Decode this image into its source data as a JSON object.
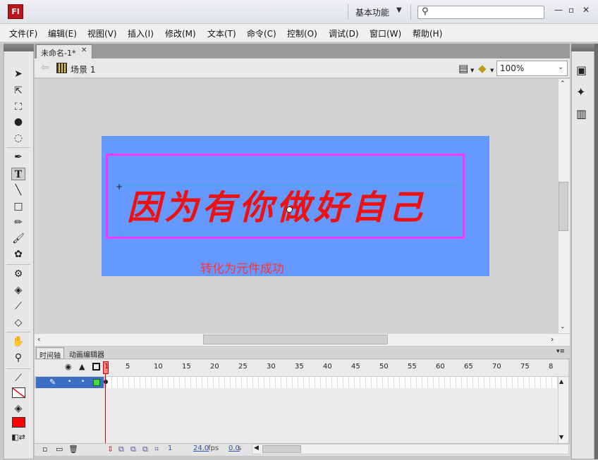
{
  "app": {
    "logo": "Fl",
    "workspace": "基本功能",
    "search_placeholder": ""
  },
  "menu": [
    "文件(F)",
    "编辑(E)",
    "视图(V)",
    "插入(I)",
    "修改(M)",
    "文本(T)",
    "命令(C)",
    "控制(O)",
    "调试(D)",
    "窗口(W)",
    "帮助(H)"
  ],
  "document": {
    "tab_title": "未命名-1*",
    "scene": "场景 1",
    "zoom": "100%"
  },
  "stage": {
    "text": "因为有你做好自己",
    "caption": "转化为元件成功",
    "stage_color": "#6699ff",
    "symbol_border_color": "#ff33ff",
    "text_color": "#ee1111",
    "caption_color": "#ff3333"
  },
  "timeline": {
    "tabs": [
      "时间轴",
      "动画编辑器"
    ],
    "frame_numbers": [
      "1",
      "5",
      "10",
      "15",
      "20",
      "25",
      "30",
      "35",
      "40",
      "45",
      "50",
      "55",
      "60",
      "65",
      "70",
      "75",
      "8"
    ],
    "current_frame": "1",
    "fps": "24.0",
    "fps_unit": "fps",
    "time": "0.0",
    "time_unit": "s"
  },
  "colors": {
    "stroke": "#000000",
    "fill": "#ff0000"
  },
  "tools": [
    "selection-tool",
    "subselection-tool",
    "free-transform-tool",
    "3d-rotation-tool",
    "lasso-tool",
    "pen-tool",
    "text-tool",
    "line-tool",
    "rectangle-tool",
    "pencil-tool",
    "brush-tool",
    "deco-tool",
    "bone-tool",
    "paint-bucket-tool",
    "eyedropper-tool",
    "eraser-tool",
    "hand-tool",
    "zoom-tool"
  ]
}
